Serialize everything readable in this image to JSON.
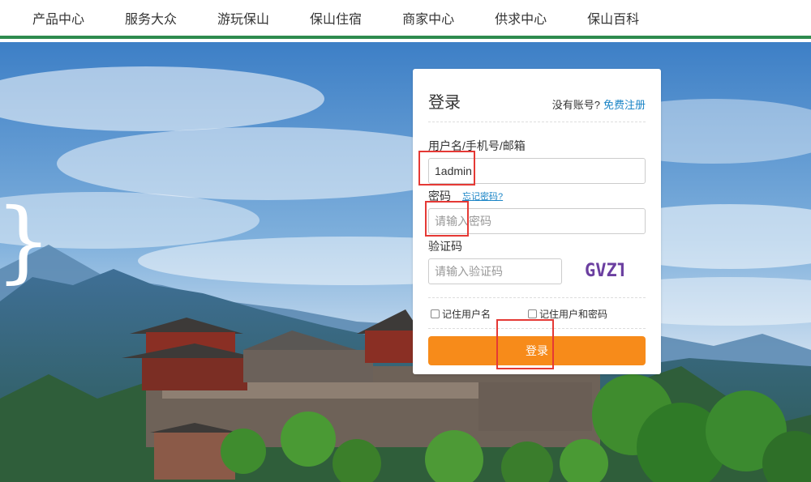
{
  "nav": {
    "items": [
      "产品中心",
      "服务大众",
      "游玩保山",
      "保山住宿",
      "商家中心",
      "供求中心",
      "保山百科"
    ]
  },
  "login": {
    "title": "登录",
    "no_account": "没有账号?",
    "register_link": "免费注册",
    "username_label": "用户名/手机号/邮箱",
    "username_value": "1admin",
    "password_label": "密码",
    "forgot_link": "忘记密码?",
    "password_placeholder": "请输入密码",
    "captcha_label": "验证码",
    "captcha_placeholder": "请输入验证码",
    "captcha_text": "GVZT",
    "remember_user": "记住用户名",
    "remember_user_pass": "记住用户和密码",
    "submit_label": "登录"
  },
  "hero": {
    "glyph": "}"
  },
  "colors": {
    "nav_border": "#2e8b4f",
    "button": "#f78b1a",
    "link": "#1a84c6",
    "annotation": "#e53935"
  }
}
